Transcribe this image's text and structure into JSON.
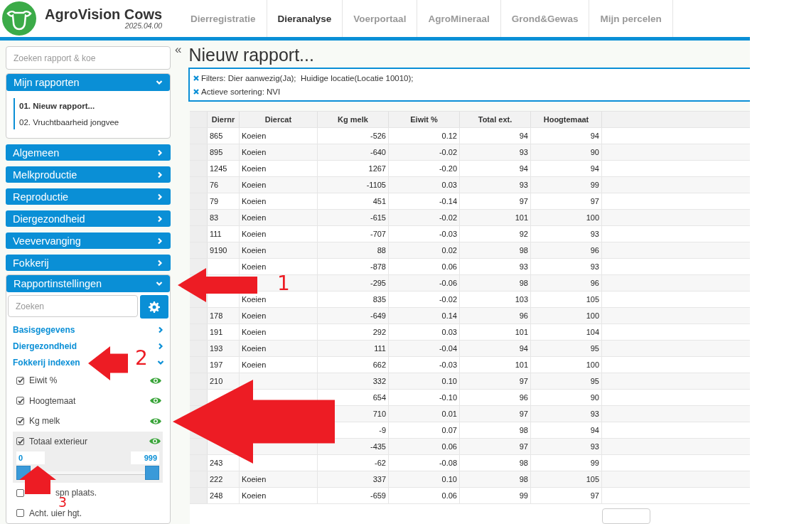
{
  "app": {
    "name": "AgroVision Cows",
    "version": "2025.04.00"
  },
  "nav_tabs": [
    {
      "label": "Dierregistratie",
      "selected": false
    },
    {
      "label": "Dieranalyse",
      "selected": true
    },
    {
      "label": "Voerportaal",
      "selected": false
    },
    {
      "label": "AgroMineraal",
      "selected": false
    },
    {
      "label": "Grond&Gewas",
      "selected": false
    },
    {
      "label": "Mijn percelen",
      "selected": false
    }
  ],
  "sidebar": {
    "search_placeholder": "Zoeken rapport & koe",
    "collapse_glyph": "«",
    "my_reports": {
      "title": "Mijn rapporten",
      "expanded": true,
      "items": [
        {
          "label": "01. Nieuw rapport...",
          "selected": true
        },
        {
          "label": "02. Vruchtbaarheid jongvee",
          "selected": false
        }
      ]
    },
    "sections": [
      {
        "title": "Algemeen",
        "expanded": false
      },
      {
        "title": "Melkproductie",
        "expanded": false
      },
      {
        "title": "Reproductie",
        "expanded": false
      },
      {
        "title": "Diergezondheid",
        "expanded": false
      },
      {
        "title": "Veevervanging",
        "expanded": false
      },
      {
        "title": "Fokkerij",
        "expanded": false
      }
    ],
    "settings": {
      "title": "Rapportinstellingen",
      "expanded": true,
      "search_placeholder": "Zoeken",
      "groups": [
        {
          "title": "Basisgegevens",
          "expanded": false
        },
        {
          "title": "Diergezondheid",
          "expanded": false
        },
        {
          "title": "Fokkerij indexen",
          "expanded": true
        }
      ],
      "fields": [
        {
          "label": "Eiwit %",
          "checked": true,
          "visible": true
        },
        {
          "label": "Hoogtemaat",
          "checked": true,
          "visible": true
        },
        {
          "label": "Kg melk",
          "checked": true,
          "visible": true
        },
        {
          "label": "Totaal exterieur",
          "checked": true,
          "visible": true,
          "range": {
            "min": "0",
            "max": "999",
            "handles": [
              {
                "level": 0
              },
              {
                "level": 1
              }
            ]
          }
        },
        {
          "label": "spn plaats.",
          "checked": false,
          "visible": false,
          "label_covered_start": true
        },
        {
          "label": "Acht. uier hgt.",
          "checked": false,
          "visible": false
        }
      ]
    }
  },
  "report": {
    "title": "Nieuw rapport...",
    "filters": [
      "Filters: Dier aanwezig(Ja);  Huidige locatie(Locatie 10010);",
      "Actieve sortering: NVI"
    ],
    "columns": [
      "Diernr",
      "Diercat",
      "Kg melk",
      "Eiwit %",
      "Total ext.",
      "Hoogtemaat"
    ],
    "rows": [
      {
        "diernr": "865",
        "diercat": "Koeien",
        "kg_melk": "-526",
        "eiwit": "0.12",
        "total_ext": "94",
        "hoogtemaat": "94"
      },
      {
        "diernr": "895",
        "diercat": "Koeien",
        "kg_melk": "-640",
        "eiwit": "-0.02",
        "total_ext": "93",
        "hoogtemaat": "90"
      },
      {
        "diernr": "1245",
        "diercat": "Koeien",
        "kg_melk": "1267",
        "eiwit": "-0.20",
        "total_ext": "94",
        "hoogtemaat": "94"
      },
      {
        "diernr": "76",
        "diercat": "Koeien",
        "kg_melk": "-1105",
        "eiwit": "0.03",
        "total_ext": "93",
        "hoogtemaat": "99"
      },
      {
        "diernr": "79",
        "diercat": "Koeien",
        "kg_melk": "451",
        "eiwit": "-0.14",
        "total_ext": "97",
        "hoogtemaat": "97"
      },
      {
        "diernr": "83",
        "diercat": "Koeien",
        "kg_melk": "-615",
        "eiwit": "-0.02",
        "total_ext": "101",
        "hoogtemaat": "100"
      },
      {
        "diernr": "111",
        "diercat": "Koeien",
        "kg_melk": "-707",
        "eiwit": "-0.03",
        "total_ext": "92",
        "hoogtemaat": "93"
      },
      {
        "diernr": "9190",
        "diercat": "Koeien",
        "kg_melk": "88",
        "eiwit": "0.02",
        "total_ext": "98",
        "hoogtemaat": "96"
      },
      {
        "diercat": "Koeien",
        "kg_melk": "-878",
        "eiwit": "0.06",
        "total_ext": "93",
        "hoogtemaat": "93"
      },
      {
        "kg_melk": "-295",
        "eiwit": "-0.06",
        "total_ext": "98",
        "hoogtemaat": "96"
      },
      {
        "diercat": "Koeien",
        "kg_melk": "835",
        "eiwit": "-0.02",
        "total_ext": "103",
        "hoogtemaat": "105"
      },
      {
        "diernr": "178",
        "diercat": "Koeien",
        "kg_melk": "-649",
        "eiwit": "0.14",
        "total_ext": "96",
        "hoogtemaat": "100"
      },
      {
        "diernr": "191",
        "diercat": "Koeien",
        "kg_melk": "292",
        "eiwit": "0.03",
        "total_ext": "101",
        "hoogtemaat": "104"
      },
      {
        "diernr": "193",
        "diercat": "Koeien",
        "kg_melk": "111",
        "eiwit": "-0.04",
        "total_ext": "94",
        "hoogtemaat": "95"
      },
      {
        "diernr": "197",
        "diercat": "Koeien",
        "kg_melk": "662",
        "eiwit": "-0.03",
        "total_ext": "101",
        "hoogtemaat": "100"
      },
      {
        "diernr": "210",
        "kg_melk": "332",
        "eiwit": "0.10",
        "total_ext": "97",
        "hoogtemaat": "95"
      },
      {
        "kg_melk": "654",
        "eiwit": "-0.10",
        "total_ext": "96",
        "hoogtemaat": "90"
      },
      {
        "kg_melk": "710",
        "eiwit": "0.01",
        "total_ext": "97",
        "hoogtemaat": "93"
      },
      {
        "kg_melk": "-9",
        "eiwit": "0.07",
        "total_ext": "98",
        "hoogtemaat": "94"
      },
      {
        "kg_melk": "-435",
        "eiwit": "0.06",
        "total_ext": "97",
        "hoogtemaat": "93"
      },
      {
        "diernr": "243",
        "kg_melk": "-62",
        "eiwit": "-0.08",
        "total_ext": "98",
        "hoogtemaat": "99"
      },
      {
        "diernr": "222",
        "diercat": "Koeien",
        "kg_melk": "337",
        "eiwit": "0.10",
        "total_ext": "98",
        "hoogtemaat": "105"
      },
      {
        "diernr": "248",
        "diercat": "Koeien",
        "kg_melk": "-659",
        "eiwit": "0.06",
        "total_ext": "99",
        "hoogtemaat": "97"
      }
    ]
  },
  "annotations": [
    {
      "kind": "left",
      "label": "1"
    },
    {
      "kind": "left",
      "label": "2"
    },
    {
      "kind": "left"
    },
    {
      "kind": "up",
      "label": "3"
    }
  ]
}
